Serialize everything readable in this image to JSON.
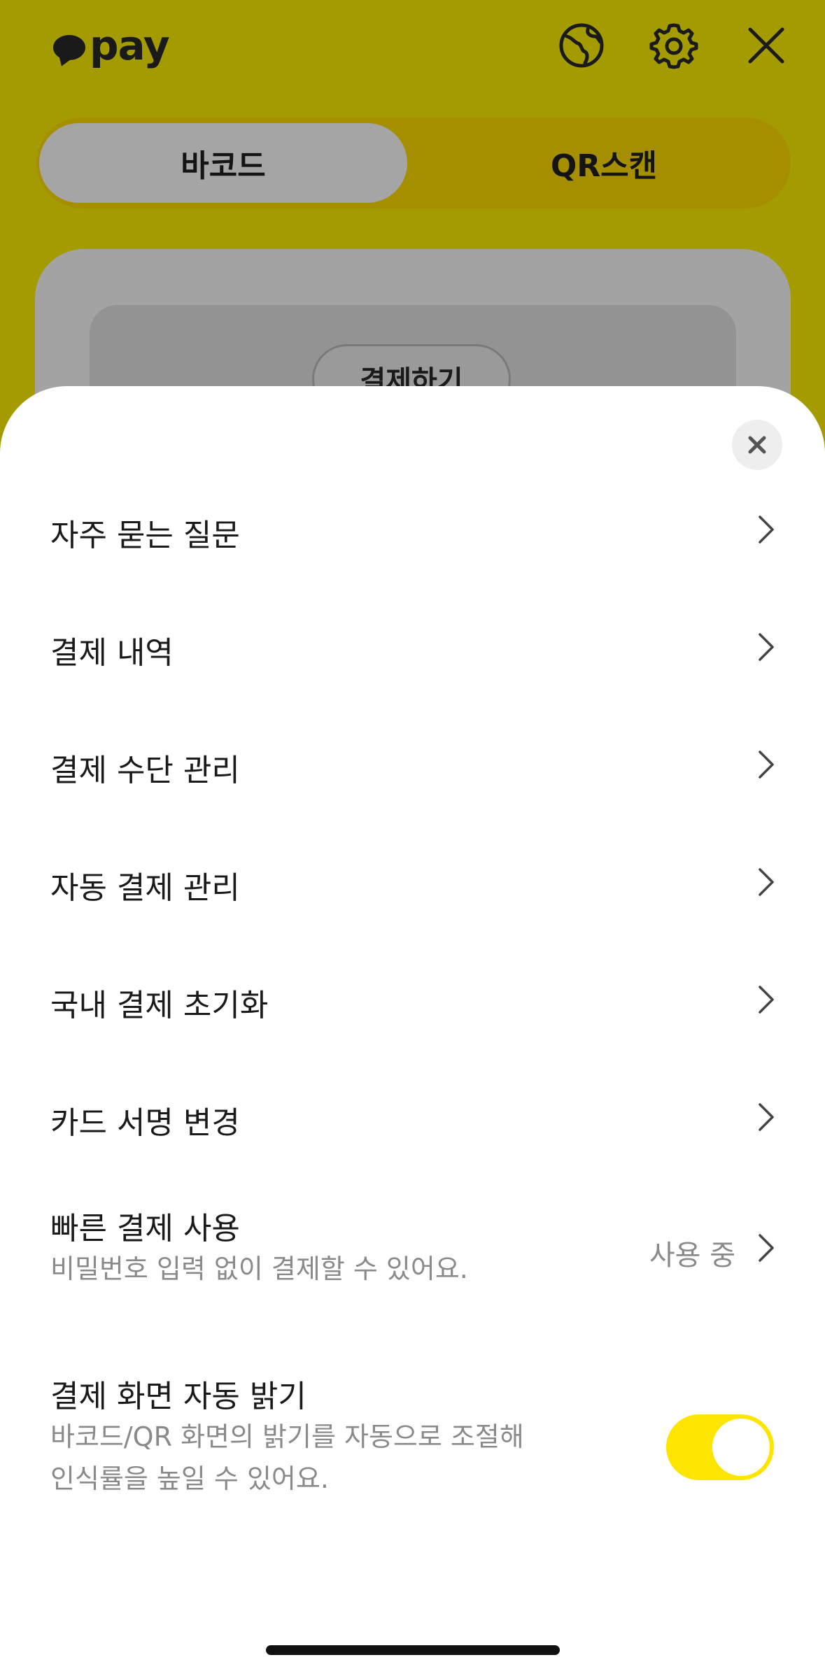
{
  "header": {
    "logo_text": "pay",
    "icons": [
      "globe-icon",
      "gear-icon",
      "close-icon"
    ]
  },
  "tabs": [
    {
      "label": "바코드",
      "active": true
    },
    {
      "label": "QR스캔",
      "active": false
    }
  ],
  "card": {
    "button_label": "결제하기"
  },
  "sheet": {
    "close_icon": "close-icon",
    "items": [
      {
        "label": "자주 묻는 질문"
      },
      {
        "label": "결제 내역"
      },
      {
        "label": "결제 수단 관리"
      },
      {
        "label": "자동 결제 관리"
      },
      {
        "label": "국내 결제 초기화"
      },
      {
        "label": "카드 서명 변경"
      }
    ],
    "fast_pay": {
      "label": "빠른 결제 사용",
      "description": "비밀번호 입력 없이 결제할 수 있어요.",
      "status": "사용 중"
    },
    "auto_brightness": {
      "label": "결제 화면 자동 밝기",
      "description_line1": "바코드/QR 화면의 밝기를 자동으로 조절해",
      "description_line2": "인식률을 높일 수 있어요.",
      "enabled": true
    }
  },
  "colors": {
    "brand_yellow": "#fee500",
    "dimmed_header": "#a39b00"
  }
}
